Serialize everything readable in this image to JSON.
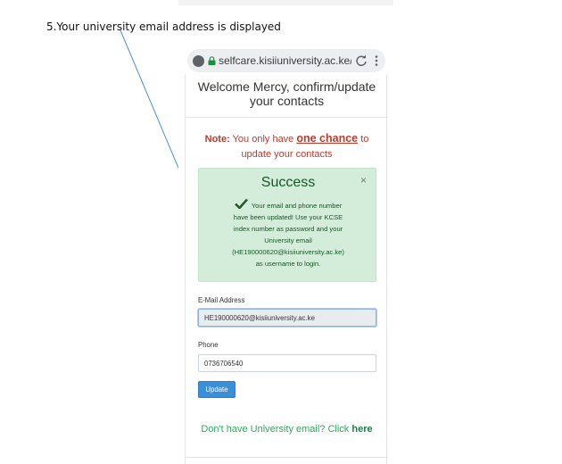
{
  "caption": "5.Your university email address is displayed",
  "browser": {
    "url": "selfcare.kisiiuniversity.ac.ke/",
    "icons": [
      "site-info-icon",
      "lock-icon",
      "reload-icon",
      "more-menu-icon"
    ]
  },
  "page": {
    "heading_line1": "Welcome Mercy, confirm/update",
    "heading_line2": "your contacts",
    "note": {
      "label": "Note:",
      "text_before": " You only have ",
      "emphasis": "one chance",
      "text_after": " to",
      "line2": "update your contacts"
    },
    "alert": {
      "title": "Success",
      "close": "×",
      "lines": [
        "Your email and phone number",
        "have been updated! Use your KCSE",
        "index number as password and your",
        "University email",
        "(HE190000620@kisiiuniversity.ac.ke)",
        "as username to login."
      ]
    },
    "form": {
      "email_label": "E-Mail Address",
      "email_value": "HE190000620@kisiiuniversity.ac.ke",
      "phone_label": "Phone",
      "phone_value": "0736706540",
      "submit_label": "Update"
    },
    "footer": {
      "text": "Don't have University email? Click ",
      "link": "here"
    }
  },
  "colors": {
    "alert_bg": "#d4edda",
    "note_red": "#c0392b",
    "button_blue": "#3a8fd9",
    "footer_green": "#2eaa5a"
  }
}
